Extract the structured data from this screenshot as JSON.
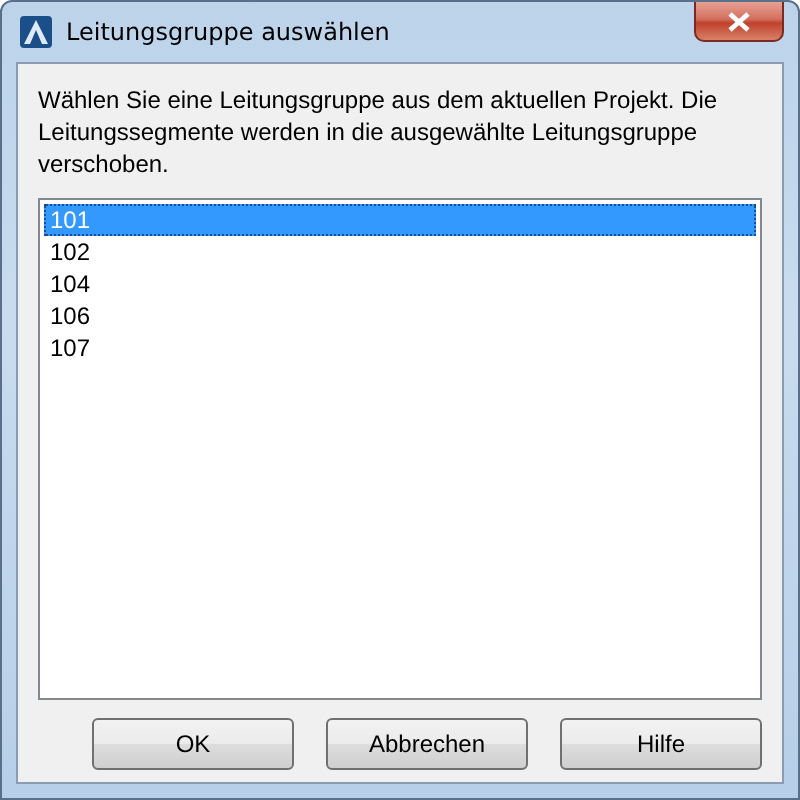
{
  "window": {
    "title": "Leitungsgruppe auswählen"
  },
  "message": "Wählen Sie eine Leitungsgruppe aus dem aktuellen Projekt. Die Leitungssegmente werden in die ausgewählte Leitungsgruppe verschoben.",
  "list": [
    {
      "label": "101",
      "selected": true
    },
    {
      "label": "102",
      "selected": false
    },
    {
      "label": "104",
      "selected": false
    },
    {
      "label": "106",
      "selected": false
    },
    {
      "label": "107",
      "selected": false
    }
  ],
  "buttons": [
    "OK",
    "Abbrechen",
    "Hilfe"
  ]
}
